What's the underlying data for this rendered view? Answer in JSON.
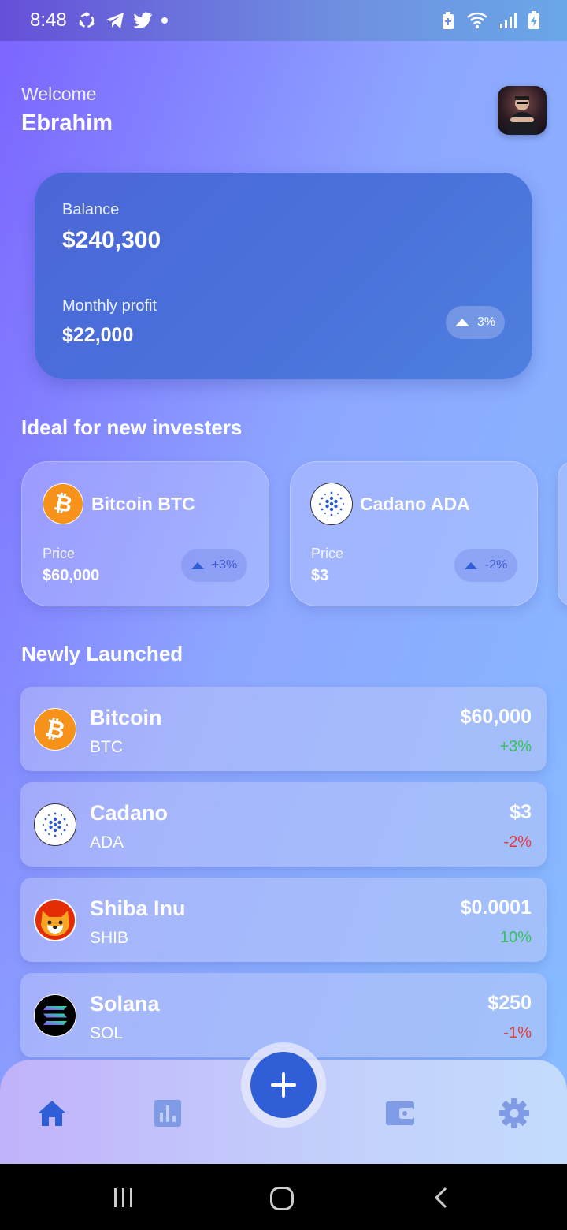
{
  "status_bar": {
    "time": "8:48"
  },
  "header": {
    "greeting": "Welcome",
    "username": "Ebrahim"
  },
  "balance_card": {
    "balance_label": "Balance",
    "balance_value": "$240,300",
    "profit_label": "Monthly profit",
    "profit_value": "$22,000",
    "profit_change": "3%"
  },
  "ideal_section": {
    "title": "Ideal for new investers",
    "cards": [
      {
        "name": "Bitcoin BTC",
        "price_label": "Price",
        "price": "$60,000",
        "change": "+3%",
        "icon": "bitcoin-icon"
      },
      {
        "name": "Cadano ADA",
        "price_label": "Price",
        "price": "$3",
        "change": "-2%",
        "icon": "cardano-icon"
      }
    ]
  },
  "new_section": {
    "title": "Newly Launched",
    "items": [
      {
        "name": "Bitcoin",
        "symbol": "BTC",
        "price": "$60,000",
        "change": "+3%",
        "direction": "up",
        "icon": "bitcoin-icon"
      },
      {
        "name": "Cadano",
        "symbol": "ADA",
        "price": "$3",
        "change": "-2%",
        "direction": "down",
        "icon": "cardano-icon"
      },
      {
        "name": "Shiba Inu",
        "symbol": "SHIB",
        "price": "$0.0001",
        "change": "10%",
        "direction": "up",
        "icon": "shiba-inu-icon"
      },
      {
        "name": "Solana",
        "symbol": "SOL",
        "price": "$250",
        "change": "-1%",
        "direction": "down",
        "icon": "solana-icon"
      }
    ]
  },
  "colors": {
    "accent": "#2f5ed6",
    "positive": "#34c35a",
    "negative": "#e03a3a",
    "bitcoin": "#f7931a"
  },
  "bottom_nav": {
    "items": [
      "home-icon",
      "chart-icon",
      "add-icon",
      "wallet-icon",
      "settings-icon"
    ],
    "active": "home-icon"
  }
}
